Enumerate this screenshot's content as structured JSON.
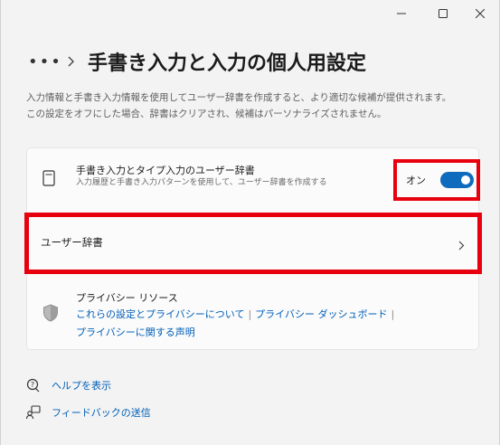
{
  "window": {
    "minimize_icon": "minimize-icon",
    "maximize_icon": "maximize-icon",
    "close_icon": "close-icon"
  },
  "header": {
    "more": "•••",
    "title": "手書き入力と入力の個人用設定"
  },
  "description": {
    "line1": "入力情報と手書き入力情報を使用してユーザー辞書を作成すると、より適切な候補が提供されます。",
    "line2": "この設定をオフにした場合、辞書はクリアされ、候補はパーソナライズされません。"
  },
  "dictionary_card": {
    "setting": {
      "title": "手書き入力とタイプ入力のユーザー辞書",
      "subtitle": "入力履歴と手書き入力パターンを使用して、ユーザー辞書を作成する",
      "toggle_label": "オン",
      "toggle_on": true,
      "icon": "notebook-icon"
    },
    "user_dictionary": {
      "label": "ユーザー辞書"
    },
    "privacy": {
      "title": "プライバシー リソース",
      "link1": "これらの設定とプライバシーについて",
      "link2": "プライバシー ダッシュボード",
      "link3": "プライバシーに関する声明",
      "separator": "|",
      "icon": "shield-icon"
    }
  },
  "footer": {
    "help": "ヘルプを表示",
    "feedback": "フィードバックの送信"
  },
  "colors": {
    "accent": "#0f6cbd",
    "link": "#005fb8",
    "highlight": "#e8000f"
  }
}
